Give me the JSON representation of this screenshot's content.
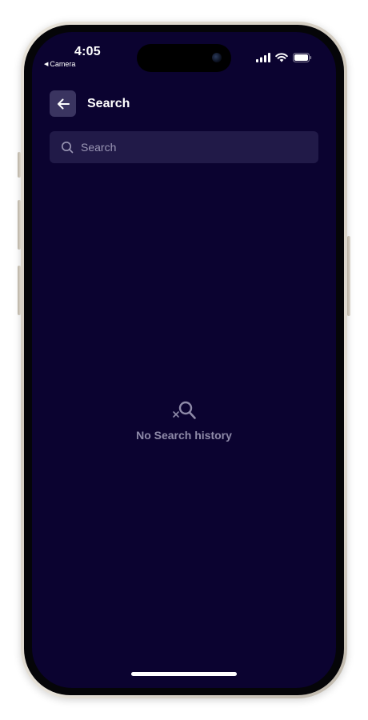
{
  "status_bar": {
    "time": "4:05",
    "back_app": "Camera"
  },
  "header": {
    "title": "Search"
  },
  "search": {
    "placeholder": "Search",
    "value": ""
  },
  "empty_state": {
    "message": "No Search history"
  },
  "colors": {
    "background": "#0b0330",
    "search_field": "#211a48",
    "back_button": "#3a3460",
    "muted_text": "#8e8aa8"
  },
  "icons": {
    "back": "arrow-left-icon",
    "search": "search-icon",
    "empty": "search-off-icon"
  }
}
